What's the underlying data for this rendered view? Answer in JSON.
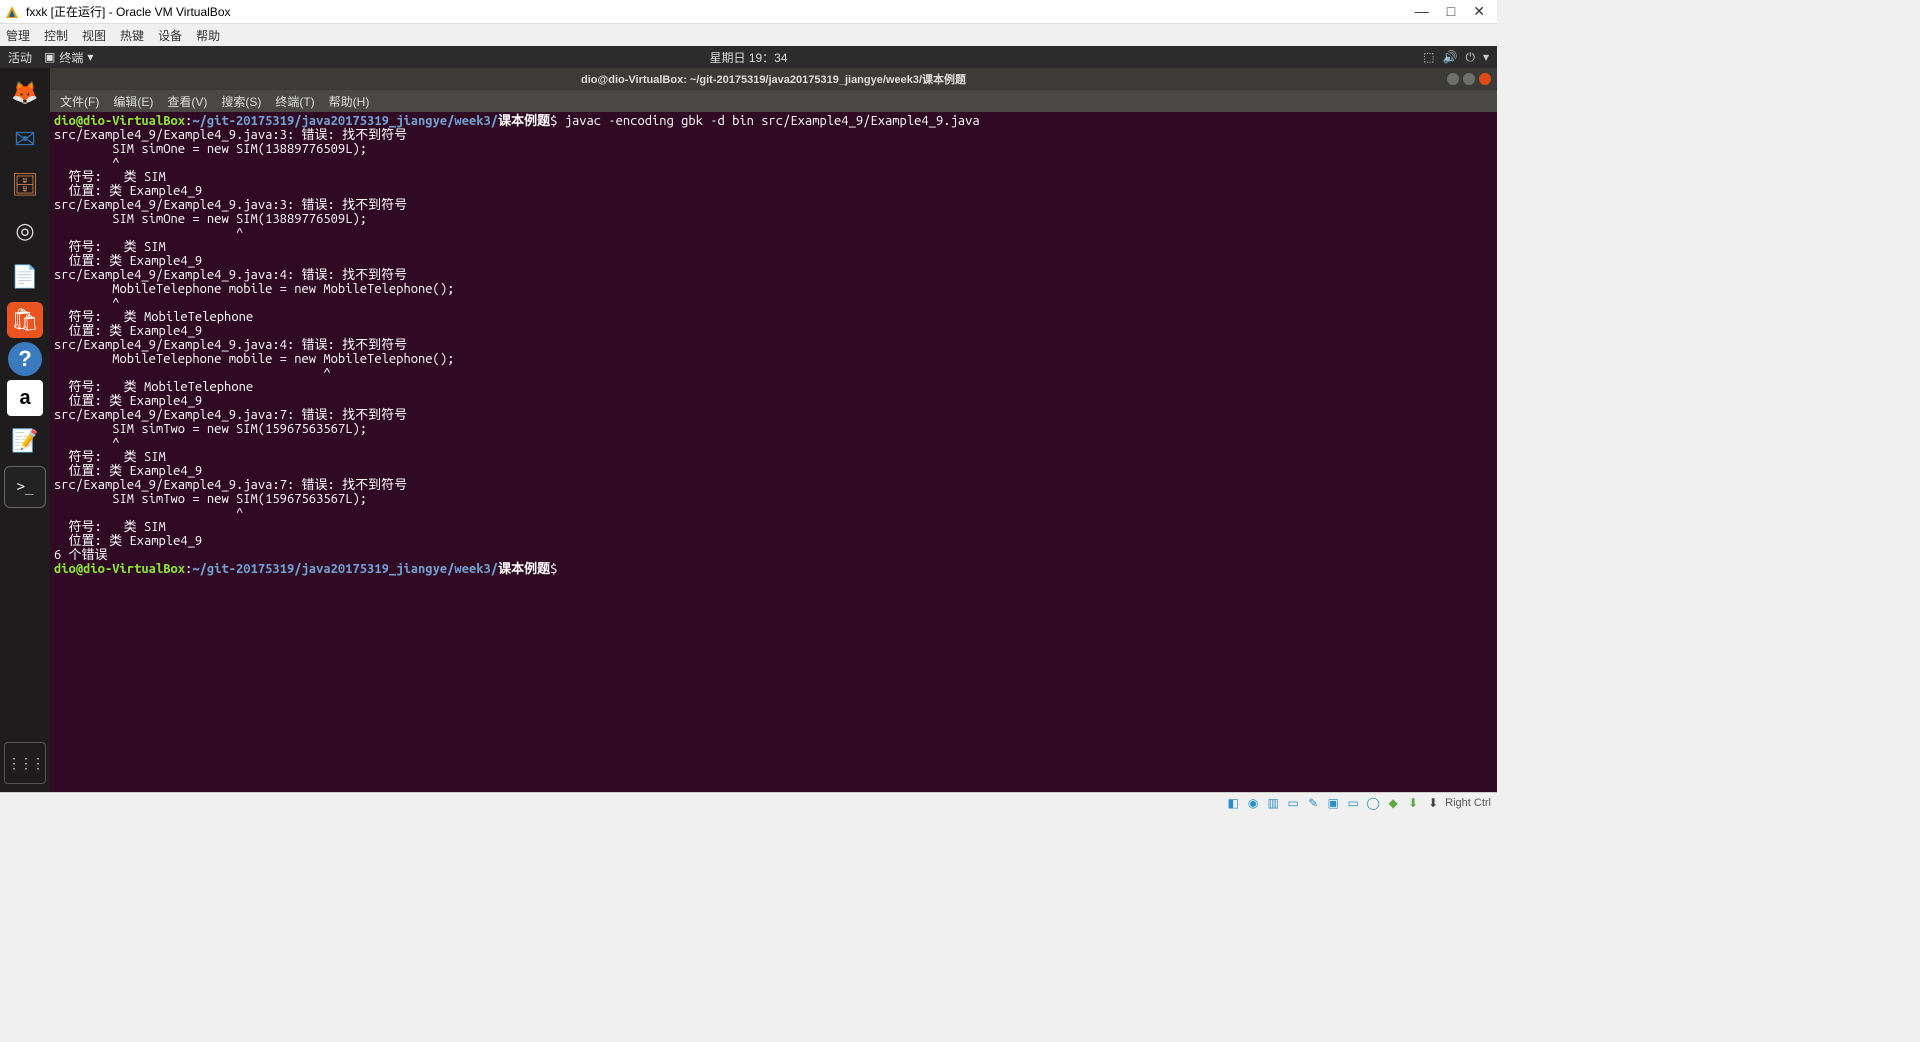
{
  "host": {
    "title": "fxxk [正在运行] - Oracle VM VirtualBox",
    "menu": [
      "管理",
      "控制",
      "视图",
      "热键",
      "设备",
      "帮助"
    ],
    "status_hostkey": "Right Ctrl",
    "wincontrols": {
      "min": "—",
      "max": "□",
      "close": "✕"
    }
  },
  "ubuntu": {
    "topbar": {
      "activities": "活动",
      "app": "终端",
      "clock": "星期日 19：34"
    },
    "appmenu_icon": "▣"
  },
  "dock": {
    "items": [
      {
        "name": "firefox",
        "glyph": "🦊"
      },
      {
        "name": "thunderbird",
        "glyph": "✉"
      },
      {
        "name": "files",
        "glyph": "🗄"
      },
      {
        "name": "rhythmbox",
        "glyph": "◎"
      },
      {
        "name": "writer",
        "glyph": "📄"
      },
      {
        "name": "software",
        "glyph": "🛍"
      },
      {
        "name": "help",
        "glyph": "?"
      },
      {
        "name": "amazon",
        "glyph": "a"
      },
      {
        "name": "texteditor",
        "glyph": "📝"
      },
      {
        "name": "terminal",
        "glyph": ">_"
      }
    ],
    "apps_glyph": "⋮⋮⋮"
  },
  "terminal": {
    "title": "dio@dio-VirtualBox: ~/git-20175319/java20175319_jiangye/week3/课本例题",
    "menu": [
      "文件(F)",
      "编辑(E)",
      "查看(V)",
      "搜索(S)",
      "终端(T)",
      "帮助(H)"
    ],
    "prompt_user": "dio@dio-VirtualBox",
    "prompt_colon": ":",
    "prompt_tilde": "~",
    "prompt_path": "/git-20175319/java20175319_jiangye/week3/",
    "prompt_cn": "课本例题",
    "prompt_dollar": "$",
    "command": " javac -encoding gbk -d bin src/Example4_9/Example4_9.java",
    "output_lines": [
      "src/Example4_9/Example4_9.java:3: 错误: 找不到符号",
      "        SIM simOne = new SIM(13889776509L);",
      "        ^",
      "  符号:   类 SIM",
      "  位置: 类 Example4_9",
      "src/Example4_9/Example4_9.java:3: 错误: 找不到符号",
      "        SIM simOne = new SIM(13889776509L);",
      "                         ^",
      "  符号:   类 SIM",
      "  位置: 类 Example4_9",
      "src/Example4_9/Example4_9.java:4: 错误: 找不到符号",
      "        MobileTelephone mobile = new MobileTelephone();",
      "        ^",
      "  符号:   类 MobileTelephone",
      "  位置: 类 Example4_9",
      "src/Example4_9/Example4_9.java:4: 错误: 找不到符号",
      "        MobileTelephone mobile = new MobileTelephone();",
      "                                     ^",
      "  符号:   类 MobileTelephone",
      "  位置: 类 Example4_9",
      "src/Example4_9/Example4_9.java:7: 错误: 找不到符号",
      "        SIM simTwo = new SIM(15967563567L);",
      "        ^",
      "  符号:   类 SIM",
      "  位置: 类 Example4_9",
      "src/Example4_9/Example4_9.java:7: 错误: 找不到符号",
      "        SIM simTwo = new SIM(15967563567L);",
      "                         ^",
      "  符号:   类 SIM",
      "  位置: 类 Example4_9",
      "6 个错误"
    ]
  }
}
